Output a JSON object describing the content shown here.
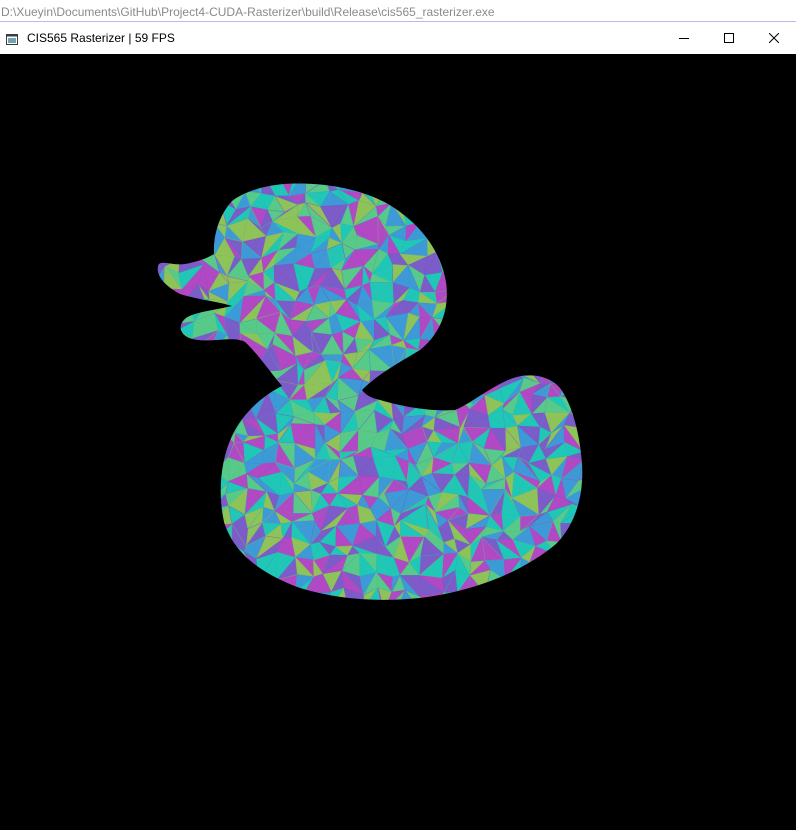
{
  "console": {
    "path": "D:\\Xueyin\\Documents\\GitHub\\Project4-CUDA-Rasterizer\\build\\Release\\cis565_rasterizer.exe"
  },
  "window": {
    "title": "CIS565 Rasterizer | 59 FPS",
    "icon": "app-window-icon",
    "controls": [
      "minimize-icon",
      "maximize-icon",
      "close-icon"
    ]
  },
  "viewport": {
    "background": "#000000",
    "model": "duck",
    "shading_palette": [
      "#20c7b6",
      "#7b5cc9",
      "#b149c4",
      "#57c989",
      "#3d9ad6",
      "#8ec35a"
    ]
  },
  "colors": {
    "console_text": "#8a8a8a",
    "accent_line": "#bfb7ea",
    "titlebar": "#ffffff"
  }
}
